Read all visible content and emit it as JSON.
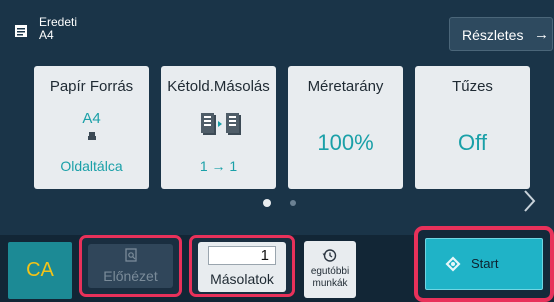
{
  "header": {
    "original_label": "Eredeti",
    "original_value": "A4",
    "original_icon": "document-icon",
    "details_label": "Részletes",
    "details_arrow": "→"
  },
  "tiles": [
    {
      "title": "Papír Forrás",
      "value": "A4",
      "detail": "Oldaltálca",
      "icon": "paper-tray-icon"
    },
    {
      "title": "Kétold.Másolás",
      "detail": "1 → 1",
      "icon": "duplex-copy-icon"
    },
    {
      "title": "Méretarány",
      "value": "100%"
    },
    {
      "title": "Tűzes",
      "value": "Off"
    }
  ],
  "pagination": {
    "pages": 2,
    "active": 1
  },
  "bottom": {
    "ca_label": "CA",
    "preview_label": "Előnézet",
    "copies_value": "1",
    "copies_label": "Másolatok",
    "recent_label_1": "egutóbbi",
    "recent_label_2": "munkák",
    "start_label": "Start"
  },
  "colors": {
    "accent": "#1aa0a8",
    "highlight": "#e8315a",
    "start": "#1fb3c7",
    "ca_text": "#f2c318"
  }
}
